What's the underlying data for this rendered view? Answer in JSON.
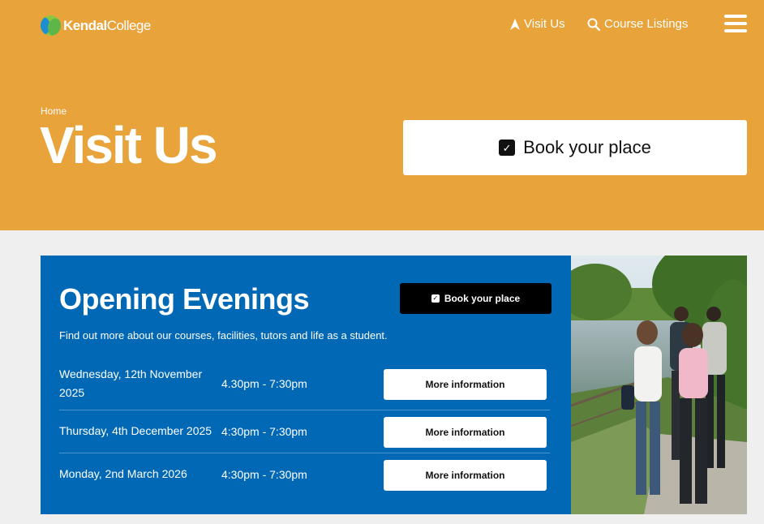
{
  "header": {
    "logo_bold": "Kendal",
    "logo_regular": "College",
    "nav": [
      {
        "label": "Visit Us",
        "icon": "navigation-arrow-icon"
      },
      {
        "label": "Course Listings",
        "icon": "search-icon"
      }
    ],
    "menu_icon": "hamburger-menu-icon"
  },
  "hero": {
    "breadcrumb": "Home",
    "title": "Visit Us",
    "book_label": "Book your place",
    "background": "#e8a33a"
  },
  "events": {
    "title": "Opening Evenings",
    "book_label": "Book your place",
    "intro": "Find out more about our courses, facilities, tutors and life as a student.",
    "background": "#0068b5",
    "rows": [
      {
        "date": "Wednesday, 12th November 2025",
        "time": "4.30pm - 7:30pm",
        "button": "More information"
      },
      {
        "date": "Thursday, 4th December 2025",
        "time": "4:30pm - 7:30pm",
        "button": "More information"
      },
      {
        "date": "Monday, 2nd March 2026",
        "time": "4:30pm - 7:30pm",
        "button": "More information"
      }
    ]
  }
}
